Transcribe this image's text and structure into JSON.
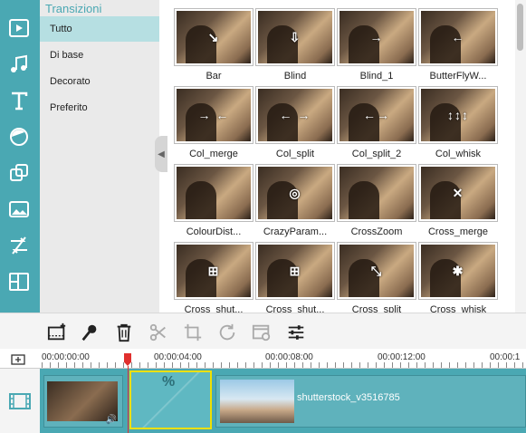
{
  "panel": {
    "title": "Transizioni",
    "categories": [
      "Tutto",
      "Di base",
      "Decorato",
      "Preferito"
    ],
    "selected": "Tutto"
  },
  "transitions": [
    {
      "label": "Bar",
      "glyph": "↘"
    },
    {
      "label": "Blind",
      "glyph": "⇩"
    },
    {
      "label": "Blind_1",
      "glyph": "→"
    },
    {
      "label": "ButterFlyW...",
      "glyph": "←"
    },
    {
      "label": "Col_merge",
      "glyph": "→ ←"
    },
    {
      "label": "Col_split",
      "glyph": "← →"
    },
    {
      "label": "Col_split_2",
      "glyph": "←→"
    },
    {
      "label": "Col_whisk",
      "glyph": "↕↕↕"
    },
    {
      "label": "ColourDist...",
      "glyph": ""
    },
    {
      "label": "CrazyParam...",
      "glyph": "◎"
    },
    {
      "label": "CrossZoom",
      "glyph": ""
    },
    {
      "label": "Cross_merge",
      "glyph": "✕"
    },
    {
      "label": "Cross_shut...",
      "glyph": "⊞"
    },
    {
      "label": "Cross_shut...",
      "glyph": "⊞"
    },
    {
      "label": "Cross_split",
      "glyph": "⤡"
    },
    {
      "label": "Cross_whisk",
      "glyph": "✱"
    }
  ],
  "timeline": {
    "timecodes": [
      "00:00:00:00",
      "00:00:04:00",
      "00:00:08:00",
      "00:00:12:00",
      "00:00:1"
    ],
    "clip_name": "shutterstock_v3516785",
    "transition_icon": "%"
  },
  "colors": {
    "accent": "#4aa8b3",
    "selected_transition_border": "#f0e000",
    "playhead": "#e0302e"
  },
  "icons": {
    "rail": [
      "media-icon",
      "music-icon",
      "text-icon",
      "filter-icon",
      "overlay-icon",
      "element-icon",
      "transition-icon",
      "split-screen-icon"
    ],
    "toolbar": [
      "add-record-icon",
      "voiceover-icon",
      "delete-icon",
      "cut-icon",
      "crop-icon",
      "rotate-icon",
      "speed-icon",
      "settings-icon"
    ]
  }
}
